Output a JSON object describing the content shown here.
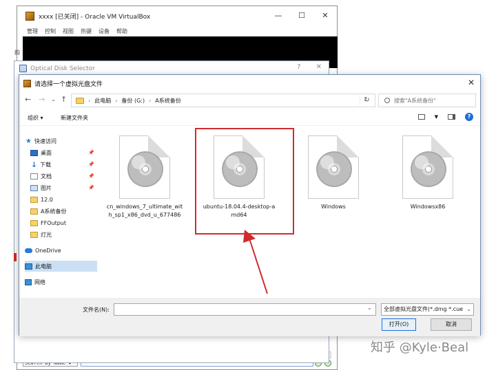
{
  "vbox": {
    "title": "xxxx [已关闭] - Oracle VM VirtualBox",
    "menu": [
      "管理",
      "控制",
      "视图",
      "热键",
      "设备",
      "帮助"
    ],
    "search_by_name": "Search By Name ▼"
  },
  "ods": {
    "title": "Optical Disk Selector",
    "help": "?",
    "close": "✕"
  },
  "edge_char": "韵",
  "dialog": {
    "title": "请选择一个虚拟光盘文件",
    "breadcrumb": [
      "此电脑",
      "备份 (G:)",
      "A系统备份"
    ],
    "search_placeholder": "搜索\"A系统备份\"",
    "toolbar": {
      "organize": "组织 ▾",
      "new_folder": "新建文件夹"
    },
    "nav": [
      {
        "label": "快速访问",
        "icon": "star-icon"
      },
      {
        "label": "桌面",
        "icon": "desktop-icon",
        "pinned": true
      },
      {
        "label": "下载",
        "icon": "download-icon",
        "pinned": true
      },
      {
        "label": "文档",
        "icon": "document-icon",
        "pinned": true
      },
      {
        "label": "图片",
        "icon": "pictures-icon",
        "pinned": true
      },
      {
        "label": "12.0",
        "icon": "folder-icon"
      },
      {
        "label": "A系统备份",
        "icon": "folder-icon"
      },
      {
        "label": "FFOutput",
        "icon": "folder-icon"
      },
      {
        "label": "灯光",
        "icon": "folder-icon"
      },
      {
        "label": "OneDrive",
        "icon": "cloud-icon"
      },
      {
        "label": "此电脑",
        "icon": "computer-icon",
        "selected": true
      },
      {
        "label": "网络",
        "icon": "network-icon"
      }
    ],
    "files": [
      {
        "name": "cn_windows_7_ultimate_with_sp1_x86_dvd_u_677486"
      },
      {
        "name": "ubuntu-18.04.4-desktop-amd64"
      },
      {
        "name": "Windows"
      },
      {
        "name": "Windowsx86"
      }
    ],
    "filename_label": "文件名(N):",
    "filename_value": "",
    "filetype": "全部虚拟光盘文件(*.dmg *.cue",
    "open_label": "打开(O)",
    "cancel_label": "取消"
  },
  "watermark": "知乎 @Kyle·Beal"
}
